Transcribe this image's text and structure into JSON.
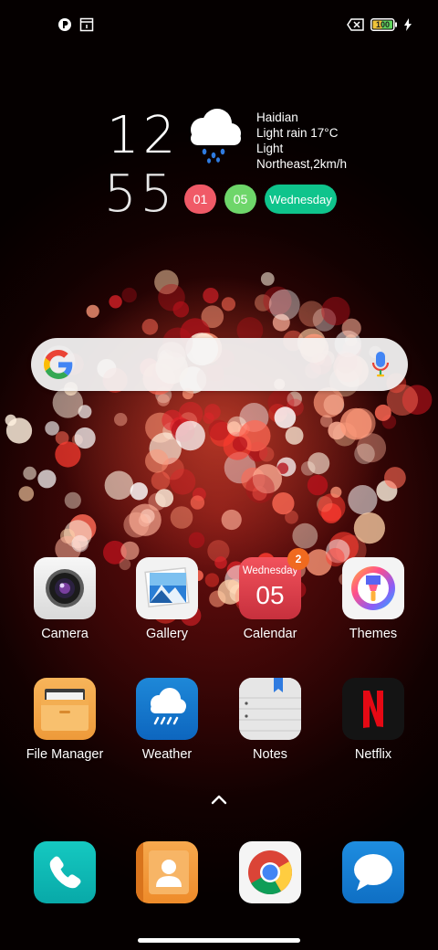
{
  "status_bar": {
    "left_icons": [
      "notification-app-icon",
      "screenshot-notification-icon"
    ],
    "battery_level": "100",
    "right_icons": [
      "no-sim-icon",
      "battery-icon",
      "charging-icon"
    ]
  },
  "clock": {
    "hour": "12",
    "minute": "55"
  },
  "weather": {
    "location": "Haidian",
    "condition": "Light rain 17°C",
    "wind_strength": "Light",
    "wind": "Northeast,2km/h"
  },
  "date": {
    "month": "01",
    "day": "05",
    "weekday": "Wednesday"
  },
  "search": {
    "logo": "google-logo",
    "mic": "mic-icon"
  },
  "apps": [
    {
      "label": "Camera",
      "icon": "camera-icon"
    },
    {
      "label": "Gallery",
      "icon": "gallery-icon"
    },
    {
      "label": "Calendar",
      "icon": "calendar-icon",
      "icon_weekday": "Wednesday",
      "icon_day": "05",
      "badge": "2"
    },
    {
      "label": "Themes",
      "icon": "themes-icon"
    },
    {
      "label": "File Manager",
      "icon": "file-manager-icon"
    },
    {
      "label": "Weather",
      "icon": "weather-icon"
    },
    {
      "label": "Notes",
      "icon": "notes-icon"
    },
    {
      "label": "Netflix",
      "icon": "netflix-icon"
    }
  ],
  "dock": [
    {
      "icon": "phone-icon"
    },
    {
      "icon": "contacts-icon"
    },
    {
      "icon": "chrome-icon"
    },
    {
      "icon": "messages-icon"
    }
  ],
  "colors": {
    "pill_month": "#f05a67",
    "pill_day": "#6ed66a",
    "pill_weekday": "#0fc48c",
    "badge": "#f06a1f",
    "wallpaper": "#6e0f0f"
  }
}
